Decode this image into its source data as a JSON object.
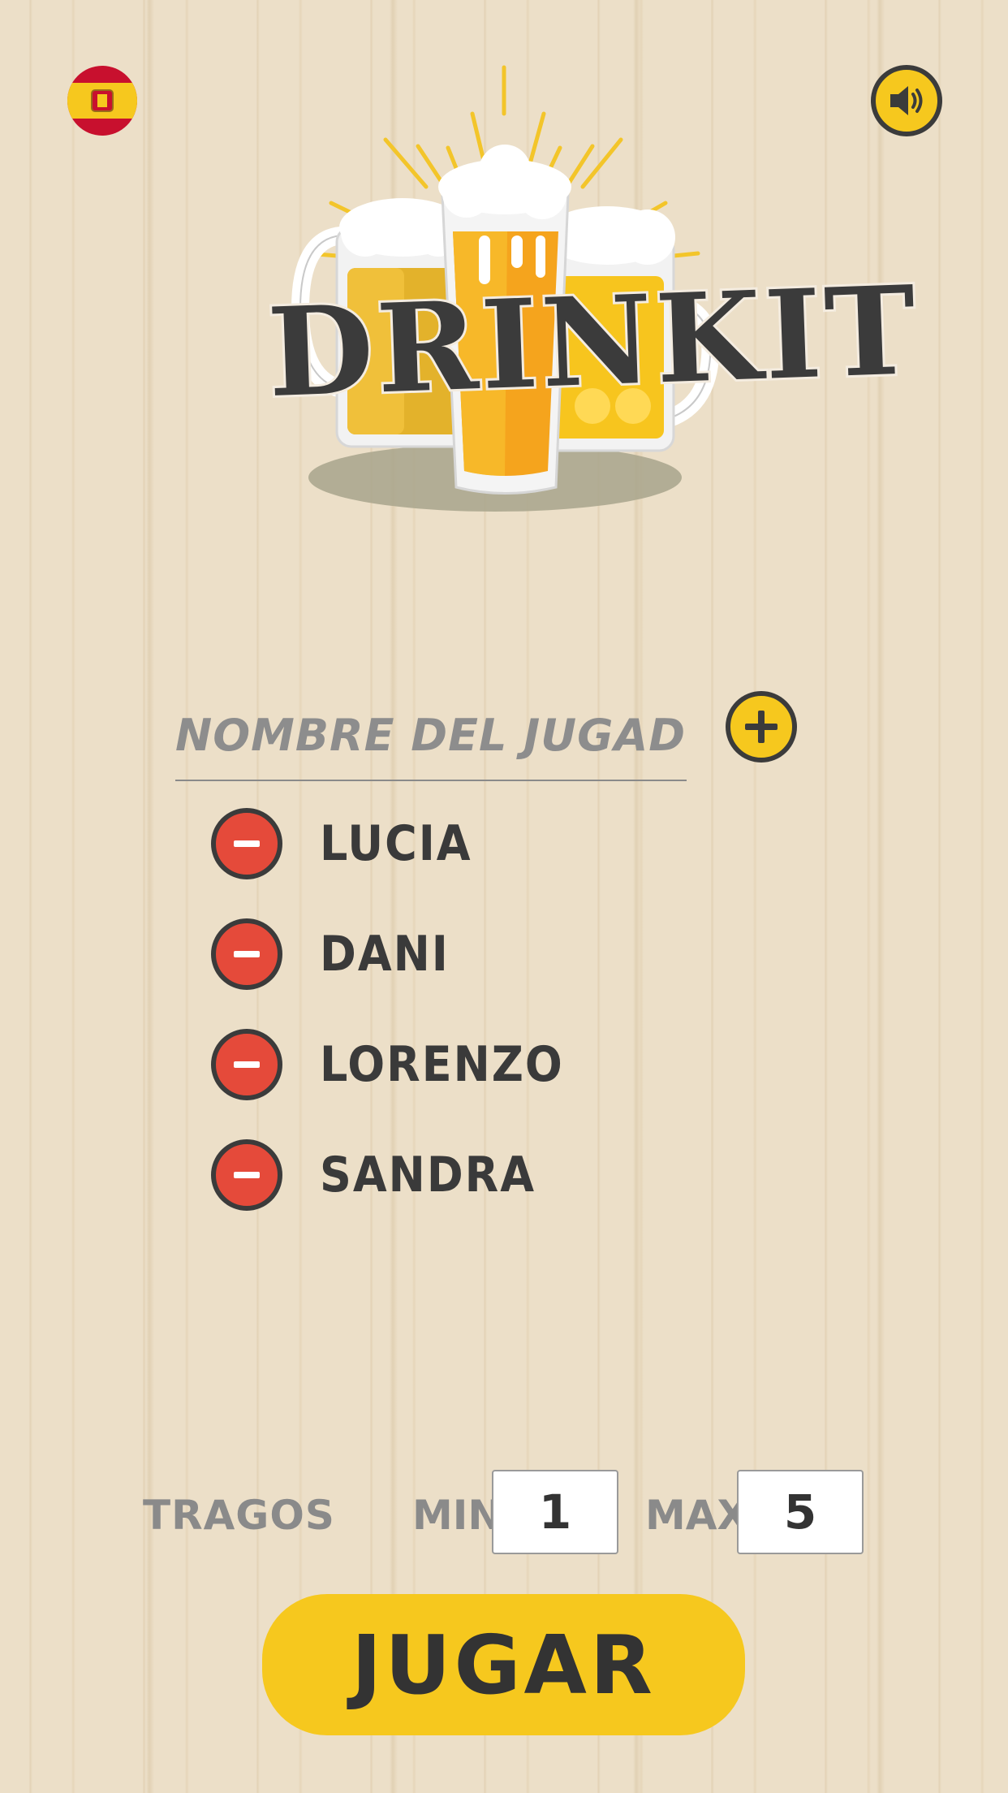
{
  "header": {
    "language": {
      "icon": "spain-flag-icon",
      "label": ""
    },
    "sound": {
      "icon": "speaker-volume-icon"
    }
  },
  "logo": {
    "title": "DRINKIT",
    "icon": "beer-glasses-icon"
  },
  "player_entry": {
    "placeholder": "NOMBRE DEL JUGADOR",
    "value": "",
    "add_icon": "plus-icon"
  },
  "players": [
    {
      "name": "LUCIA"
    },
    {
      "name": "DANI"
    },
    {
      "name": "LORENZO"
    },
    {
      "name": "SANDRA"
    }
  ],
  "drinks": {
    "label": "TRAGOS",
    "min_label": "MIN:",
    "min_value": "1",
    "max_label": "MAX:",
    "max_value": "5"
  },
  "play_button": {
    "label": "JUGAR"
  },
  "colors": {
    "background": "#ecdfc8",
    "accent_yellow": "#f6c81e",
    "remove_red": "#e54a3a",
    "dark": "#3b3b3b",
    "muted_text": "#8a8a8a"
  }
}
